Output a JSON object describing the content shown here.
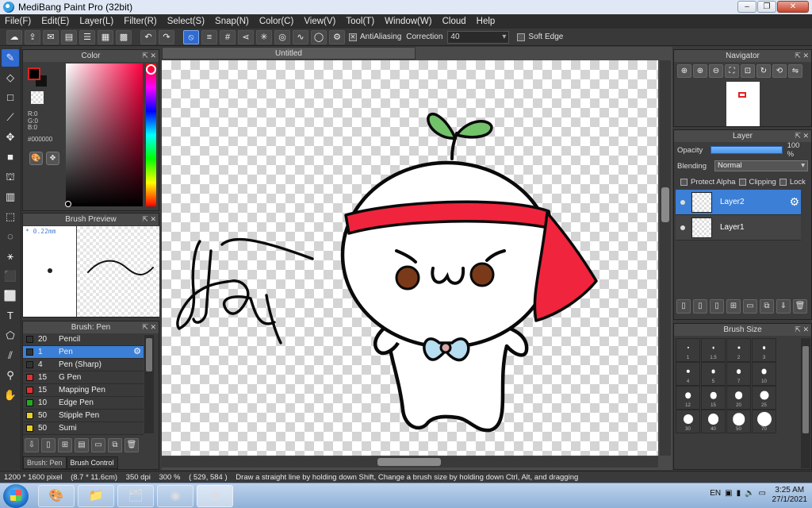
{
  "window": {
    "title": "MediBang Paint Pro (32bit)",
    "buttons": [
      "–",
      "❐",
      "✕"
    ]
  },
  "menu": [
    "File(F)",
    "Edit(E)",
    "Layer(L)",
    "Filter(R)",
    "Select(S)",
    "Snap(N)",
    "Color(C)",
    "View(V)",
    "Tool(T)",
    "Window(W)",
    "Cloud",
    "Help"
  ],
  "options": {
    "antialiasing_label": "AntiAliasing",
    "correction_label": "Correction",
    "correction_value": "40",
    "soft_edge_label": "Soft Edge"
  },
  "color_panel": {
    "title": "Color",
    "r": "R:0",
    "g": "G:0",
    "b": "B:0",
    "hex": "#000000",
    "foreground": "#000000",
    "hue_accent": "#ff0040"
  },
  "brush_preview": {
    "title": "Brush Preview",
    "size": "* 0.22mm"
  },
  "brush_panel": {
    "title": "Brush: Pen",
    "items": [
      {
        "size": "20",
        "name": "Pencil",
        "color": "#333333"
      },
      {
        "size": "1",
        "name": "Pen",
        "color": "#333333",
        "selected": true
      },
      {
        "size": "4",
        "name": "Pen (Sharp)",
        "color": "#333333"
      },
      {
        "size": "15",
        "name": "G Pen",
        "color": "#e03030"
      },
      {
        "size": "15",
        "name": "Mapping Pen",
        "color": "#e03030"
      },
      {
        "size": "10",
        "name": "Edge Pen",
        "color": "#22aa22"
      },
      {
        "size": "50",
        "name": "Stipple Pen",
        "color": "#e8d020"
      },
      {
        "size": "50",
        "name": "Sumi",
        "color": "#e8d020"
      }
    ],
    "tabs": [
      "Brush: Pen",
      "Brush Control"
    ]
  },
  "document": {
    "tab": "Untitled"
  },
  "navigator": {
    "title": "Navigator"
  },
  "layer_panel": {
    "title": "Layer",
    "opacity_label": "Opacity",
    "opacity_value": "100 %",
    "opacity_fraction": 1.0,
    "blending_label": "Blending",
    "blending_value": "Normal",
    "protect_alpha": "Protect Alpha",
    "clipping": "Clipping",
    "lock": "Lock",
    "layers": [
      {
        "name": "Layer2",
        "selected": true
      },
      {
        "name": "Layer1",
        "selected": false
      }
    ]
  },
  "brush_size": {
    "title": "Brush Size",
    "sizes": [
      "1",
      "1.5",
      "2",
      "3",
      "4",
      "5",
      "7",
      "10",
      "12",
      "15",
      "20",
      "25",
      "30",
      "40",
      "50",
      "70"
    ]
  },
  "status": {
    "pixels": "1200 * 1600 pixel",
    "cm": "(8.7 * 11.6cm)",
    "dpi": "350 dpi",
    "zoom": "300 %",
    "coords": "( 529, 584 )",
    "hint": "Draw a straight line by holding down Shift, Change a brush size by holding down Ctrl, Alt, and dragging"
  },
  "taskbar": {
    "lang": "EN",
    "time": "3:25 AM",
    "date": "27/1/2021"
  },
  "colors": {
    "accent": "#3b7fd6",
    "headband": "#f0243c",
    "leaf": "#72c26a",
    "cheek": "#7a3a1a",
    "bow": "#b6ddf0"
  }
}
